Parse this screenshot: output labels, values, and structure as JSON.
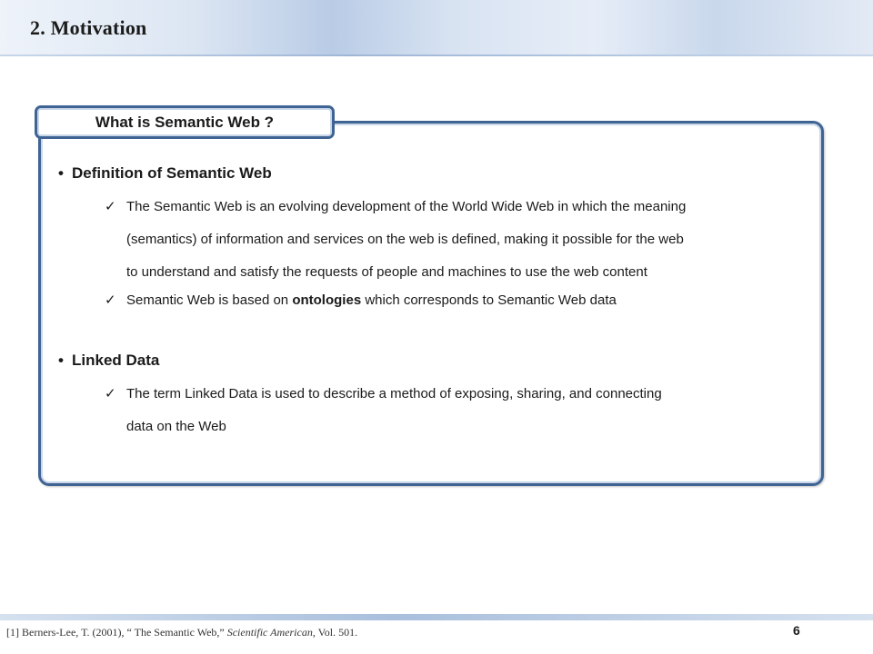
{
  "header": {
    "title": "2. Motivation"
  },
  "panel": {
    "tab_label": "What is Semantic Web ?",
    "sections": [
      {
        "bullet": "•",
        "heading": "Definition of Semantic Web",
        "items": [
          {
            "check": "✓",
            "line1": "The Semantic Web is an evolving development of the World Wide Web in which the meaning",
            "line2": "(semantics) of information and services on the web is defined, making it possible for the web",
            "line3": "to understand and satisfy the requests of people and machines to use the web content"
          },
          {
            "check": "✓",
            "before": "Semantic Web is based on ",
            "emphasis": "ontologies",
            "after": " which corresponds to Semantic Web data"
          }
        ]
      },
      {
        "bullet": "•",
        "heading": "Linked Data",
        "items": [
          {
            "check": "✓",
            "line1": "The term Linked Data is used to describe a method of exposing, sharing, and connecting",
            "line2": "data on the Web"
          }
        ]
      }
    ]
  },
  "footer": {
    "ref_prefix": "[1] Berners-Lee,  T. (2001), “ The Semantic Web,” ",
    "ref_journal": "Scientific American",
    "ref_suffix": ", Vol.  501.",
    "page_number": "6"
  },
  "colors": {
    "frame": "#3f6494",
    "header_band": "#b9cce6"
  }
}
